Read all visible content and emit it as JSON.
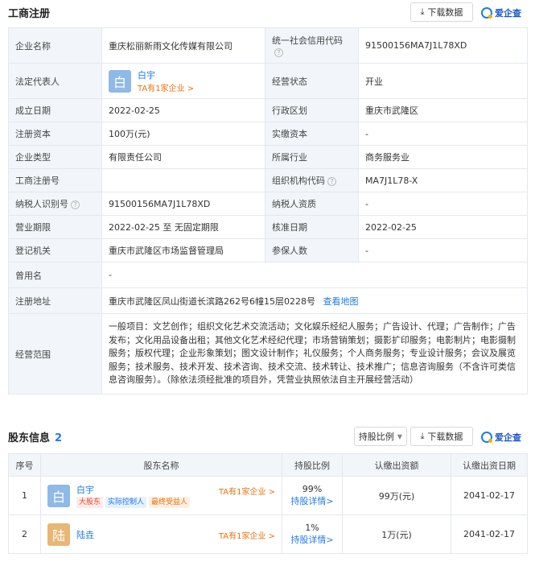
{
  "registration": {
    "title": "工商注册",
    "download_label": "下载数据",
    "logo_label": "爱企查",
    "company_name_label": "企业名称",
    "company_name": "重庆松丽新雨文化传媒有限公司",
    "credit_code_label": "统一社会信用代码",
    "credit_code": "91500156MA7J1L78XD",
    "legal_rep_label": "法定代表人",
    "legal_rep_avatar": "白",
    "legal_rep_name": "白宇",
    "legal_rep_link": "TA有1家企业 >",
    "status_label": "经营状态",
    "status": "开业",
    "founded_label": "成立日期",
    "founded": "2022-02-25",
    "district_label": "行政区划",
    "district": "重庆市武隆区",
    "capital_label": "注册资本",
    "capital": "100万(元)",
    "paid_capital_label": "实缴资本",
    "paid_capital": "-",
    "type_label": "企业类型",
    "type": "有限责任公司",
    "industry_label": "所属行业",
    "industry": "商务服务业",
    "reg_no_label": "工商注册号",
    "reg_no": "",
    "org_code_label": "组织机构代码",
    "org_code": "MA7J1L78-X",
    "taxpayer_id_label": "纳税人识别号",
    "taxpayer_id": "91500156MA7J1L78XD",
    "taxpayer_qual_label": "纳税人资质",
    "taxpayer_qual": "-",
    "term_label": "营业期限",
    "term": "2022-02-25 至 无固定期限",
    "approval_label": "核准日期",
    "approval": "2022-02-25",
    "authority_label": "登记机关",
    "authority": "重庆市武隆区市场监督管理局",
    "insured_label": "参保人数",
    "insured": "-",
    "former_name_label": "曾用名",
    "former_name": "-",
    "address_label": "注册地址",
    "address": "重庆市武隆区凤山街道长滨路262号6幢15层0228号",
    "map_link": "查看地图",
    "scope_label": "经营范围",
    "scope": "一般项目：文艺创作；组织文化艺术交流活动；文化娱乐经纪人服务；广告设计、代理；广告制作；广告发布；文化用品设备出租；其他文化艺术经纪代理；市场营销策划；摄影扩印服务；电影制片；电影摄制服务；版权代理；企业形象策划；图文设计制作；礼仪服务；个人商务服务；专业设计服务；会议及展览服务；技术服务、技术开发、技术咨询、技术交流、技术转让、技术推广；信息咨询服务（不含许可类信息咨询服务）。（除依法须经批准的项目外，凭营业执照依法自主开展经营活动）"
  },
  "shareholders": {
    "title": "股东信息",
    "count": "2",
    "ratio_btn": "持股比例",
    "download_label": "下载数据",
    "logo_label": "爱企查",
    "headers": [
      "序号",
      "股东名称",
      "持股比例",
      "认缴出资额",
      "认缴出资日期"
    ],
    "rows": [
      {
        "no": "1",
        "avatar": "白",
        "name": "白宇",
        "link": "TA有1家企业 >",
        "tags": [
          "大股东",
          "实际控制人",
          "最终受益人"
        ],
        "ratio": "99%",
        "detail": "持股详情>",
        "amount": "99万(元)",
        "date": "2041-02-17"
      },
      {
        "no": "2",
        "avatar": "陆",
        "name": "陆垚",
        "link": "TA有1家企业 >",
        "tags": [],
        "ratio": "1%",
        "detail": "持股详情>",
        "amount": "1万(元)",
        "date": "2041-02-17"
      }
    ]
  }
}
